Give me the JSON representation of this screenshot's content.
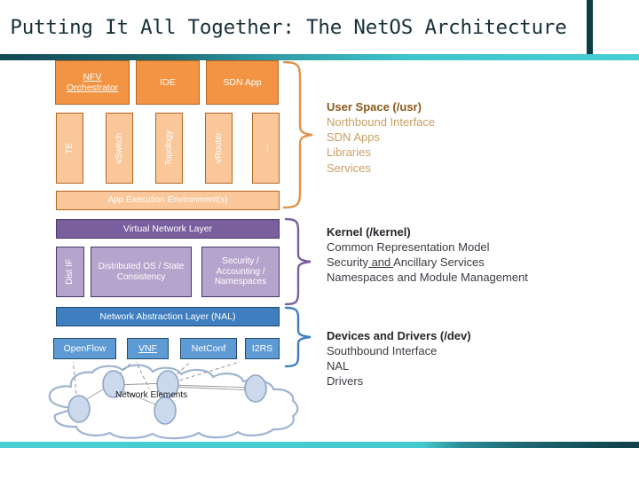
{
  "slide": {
    "title": "Putting It All Together: The NetOS Architecture"
  },
  "colors": {
    "accent_dark_teal": "#0d3d47",
    "accent_cyan": "#49cfd3",
    "orange": "#f29444",
    "orange_light": "#f9c79a",
    "orange_border": "#b5651f",
    "purple": "#7a5f9e",
    "purple_light": "#b6a4cd",
    "blue": "#3f7fbf",
    "blue_light": "#5e9bd4",
    "userspace_heading": "#8a5a1b",
    "userspace_body": "#c9a063",
    "kernel_text": "#3b3b45"
  },
  "user_space_group": {
    "apps_row": [
      {
        "label": "NFV Orchestrator",
        "underlined": true
      },
      {
        "label": "IDE",
        "underlined": false
      },
      {
        "label": "SDN App",
        "underlined": false
      }
    ],
    "services_row": [
      {
        "label": "TE"
      },
      {
        "label": "vSwitch"
      },
      {
        "label": "Topology"
      },
      {
        "label": "vRouter"
      },
      {
        "label": "…"
      }
    ],
    "execution_environment": "App Execution Environment(s)"
  },
  "kernel_group": {
    "virtual_network_layer": "Virtual Network Layer",
    "modules": [
      {
        "label": "Dist IF",
        "vertical": true
      },
      {
        "label": "Distributed OS / State Consistency",
        "vertical": false
      },
      {
        "label": "Security / Accounting / Namespaces",
        "vertical": false
      }
    ]
  },
  "device_group": {
    "nal": "Network Abstraction Layer (NAL)",
    "protocols": [
      {
        "label": "OpenFlow",
        "underlined": false
      },
      {
        "label": "VNF",
        "underlined": true
      },
      {
        "label": "NetConf",
        "underlined": false
      },
      {
        "label": "I2RS",
        "underlined": false
      }
    ],
    "network_elements_label": "Network Elements"
  },
  "annotations": {
    "user_space": {
      "heading": "User Space (/usr)",
      "lines": [
        "Northbound Interface",
        "SDN Apps",
        "Libraries",
        "Services"
      ]
    },
    "kernel": {
      "heading": "Kernel (/kernel)",
      "lines": [
        "Common Representation Model",
        "Security and Ancillary Services",
        "Namespaces and Module Management"
      ],
      "line2_pre": "Security",
      "line2_underlined": " and ",
      "line2_post": "Ancillary Services"
    },
    "devices": {
      "heading": "Devices and Drivers (/dev)",
      "lines": [
        "Southbound Interface",
        "NAL",
        "Drivers"
      ]
    }
  },
  "icons": {
    "brace_user_space": "curly-brace-icon",
    "brace_kernel": "curly-brace-icon",
    "brace_devices": "curly-brace-icon",
    "cloud": "cloud-icon",
    "node": "network-node-icon"
  }
}
